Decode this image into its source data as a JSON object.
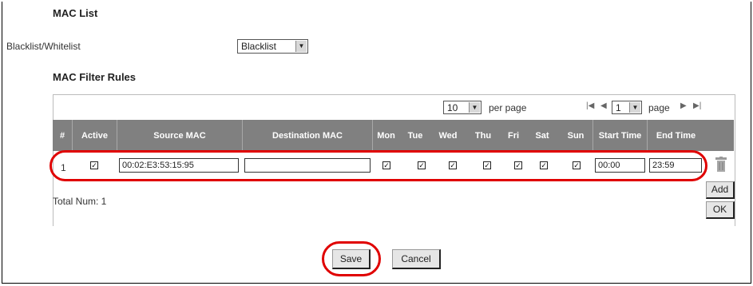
{
  "mac_list": {
    "heading": "MAC List",
    "mode_label": "Blacklist/Whitelist",
    "mode_value": "Blacklist"
  },
  "rules": {
    "heading": "MAC Filter Rules",
    "pagination": {
      "per_page_value": "10",
      "per_page_label": "per page",
      "page_value": "1",
      "page_label": "page"
    },
    "columns": {
      "index": "#",
      "active": "Active",
      "source_mac": "Source MAC",
      "destination_mac": "Destination MAC",
      "mon": "Mon",
      "tue": "Tue",
      "wed": "Wed",
      "thu": "Thu",
      "fri": "Fri",
      "sat": "Sat",
      "sun": "Sun",
      "start_time": "Start Time",
      "end_time": "End Time"
    },
    "rows": [
      {
        "index": "1",
        "active": true,
        "source_mac": "00:02:E3:53:15:95",
        "destination_mac": "",
        "days": [
          true,
          true,
          true,
          true,
          true,
          true,
          true
        ],
        "start_time": "00:00",
        "end_time": "23:59"
      }
    ],
    "total_label": "Total Num: 1",
    "add_label": "Add",
    "ok_label": "OK"
  },
  "footer": {
    "save_label": "Save",
    "cancel_label": "Cancel"
  },
  "accent": "#e00000",
  "header_color": "#808080"
}
